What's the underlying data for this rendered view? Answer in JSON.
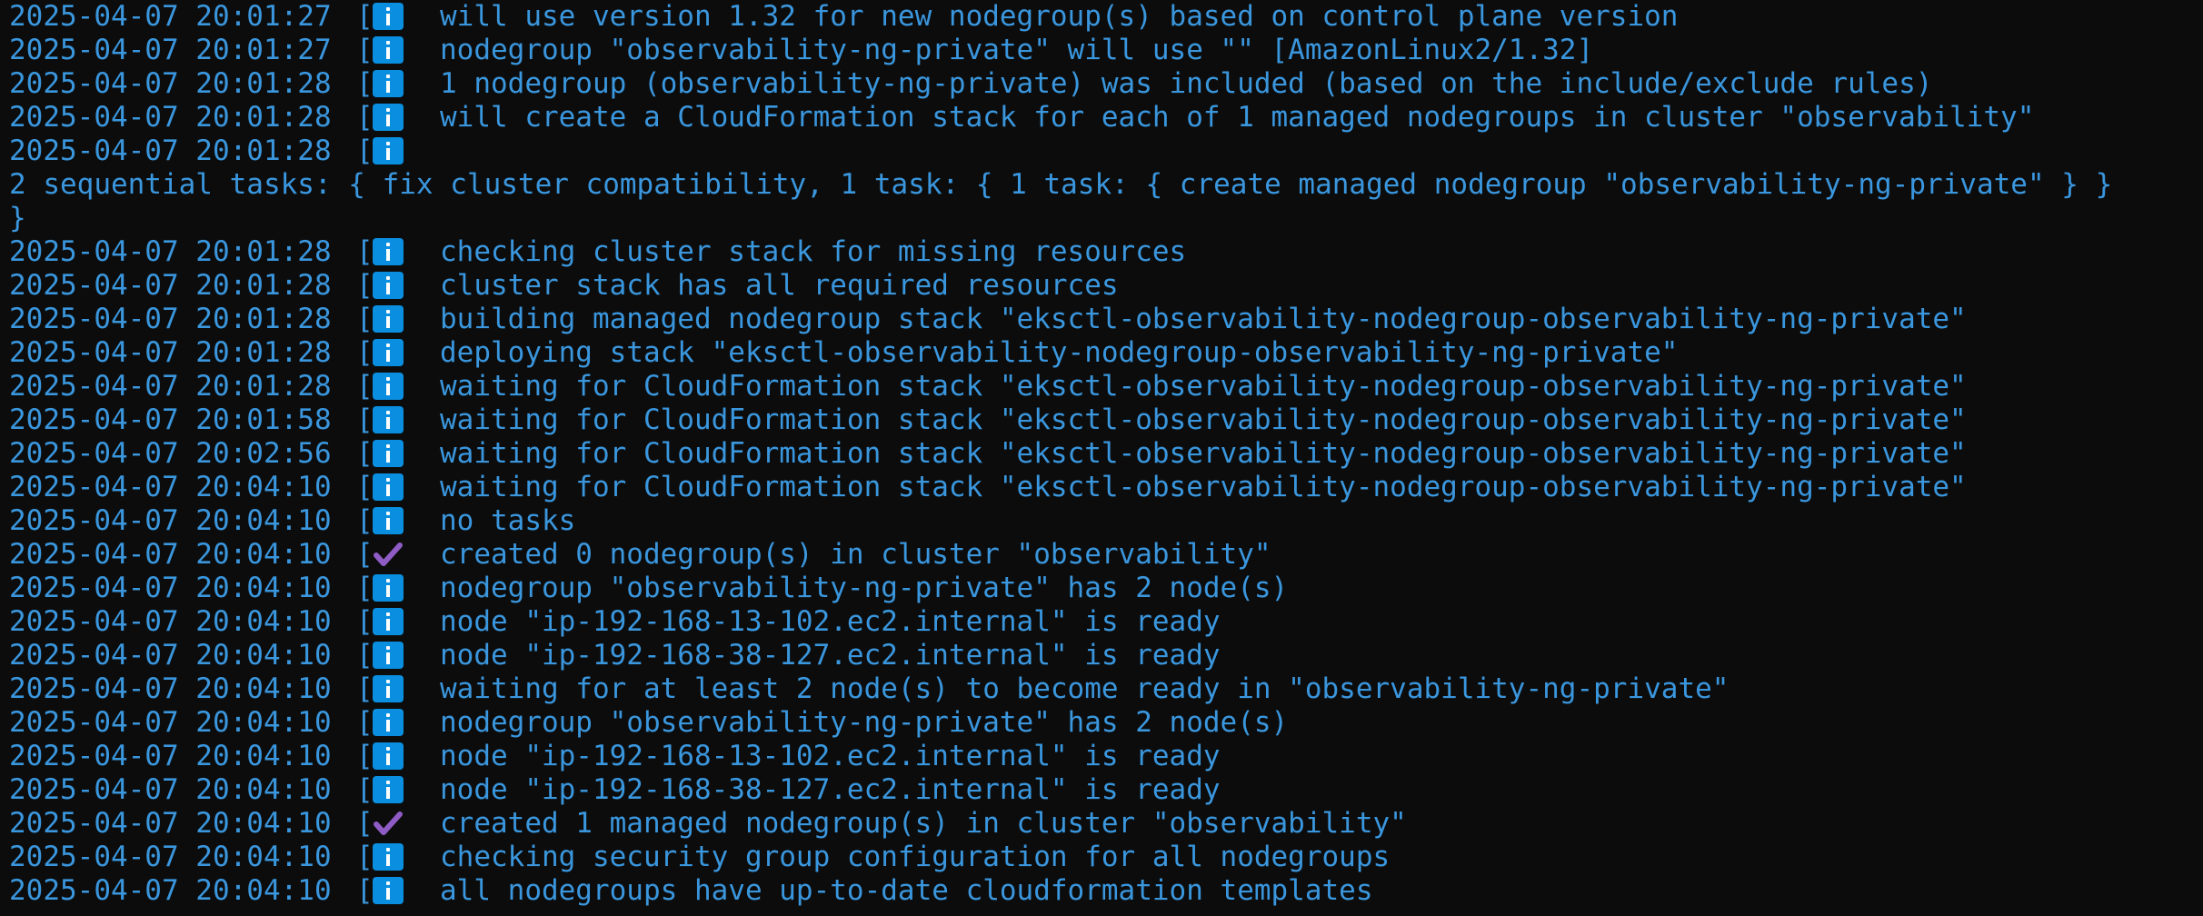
{
  "terminal": {
    "colors": {
      "background": "#0c0c0c",
      "text": "#3a96dd",
      "info_icon": "#0a8fe0",
      "check_icon": "#8e5cc4"
    },
    "lines": [
      {
        "ts": "2025-04-07 20:01:27",
        "icon": "info",
        "msg": "will use version 1.32 for new nodegroup(s) based on control plane version"
      },
      {
        "ts": "2025-04-07 20:01:27",
        "icon": "info",
        "msg": "nodegroup \"observability-ng-private\" will use \"\" [AmazonLinux2/1.32]"
      },
      {
        "ts": "2025-04-07 20:01:28",
        "icon": "info",
        "msg": "1 nodegroup (observability-ng-private) was included (based on the include/exclude rules)"
      },
      {
        "ts": "2025-04-07 20:01:28",
        "icon": "info",
        "msg": "will create a CloudFormation stack for each of 1 managed nodegroups in cluster \"observability\""
      },
      {
        "ts": "2025-04-07 20:01:28",
        "icon": "info",
        "msg": ""
      },
      {
        "plain": "2 sequential tasks: { fix cluster compatibility, 1 task: { 1 task: { create managed nodegroup \"observability-ng-private\" } }"
      },
      {
        "plain": "}"
      },
      {
        "ts": "2025-04-07 20:01:28",
        "icon": "info",
        "msg": "checking cluster stack for missing resources"
      },
      {
        "ts": "2025-04-07 20:01:28",
        "icon": "info",
        "msg": "cluster stack has all required resources"
      },
      {
        "ts": "2025-04-07 20:01:28",
        "icon": "info",
        "msg": "building managed nodegroup stack \"eksctl-observability-nodegroup-observability-ng-private\""
      },
      {
        "ts": "2025-04-07 20:01:28",
        "icon": "info",
        "msg": "deploying stack \"eksctl-observability-nodegroup-observability-ng-private\""
      },
      {
        "ts": "2025-04-07 20:01:28",
        "icon": "info",
        "msg": "waiting for CloudFormation stack \"eksctl-observability-nodegroup-observability-ng-private\""
      },
      {
        "ts": "2025-04-07 20:01:58",
        "icon": "info",
        "msg": "waiting for CloudFormation stack \"eksctl-observability-nodegroup-observability-ng-private\""
      },
      {
        "ts": "2025-04-07 20:02:56",
        "icon": "info",
        "msg": "waiting for CloudFormation stack \"eksctl-observability-nodegroup-observability-ng-private\""
      },
      {
        "ts": "2025-04-07 20:04:10",
        "icon": "info",
        "msg": "waiting for CloudFormation stack \"eksctl-observability-nodegroup-observability-ng-private\""
      },
      {
        "ts": "2025-04-07 20:04:10",
        "icon": "info",
        "msg": "no tasks"
      },
      {
        "ts": "2025-04-07 20:04:10",
        "icon": "check",
        "msg": "created 0 nodegroup(s) in cluster \"observability\""
      },
      {
        "ts": "2025-04-07 20:04:10",
        "icon": "info",
        "msg": "nodegroup \"observability-ng-private\" has 2 node(s)"
      },
      {
        "ts": "2025-04-07 20:04:10",
        "icon": "info",
        "msg": "node \"ip-192-168-13-102.ec2.internal\" is ready"
      },
      {
        "ts": "2025-04-07 20:04:10",
        "icon": "info",
        "msg": "node \"ip-192-168-38-127.ec2.internal\" is ready"
      },
      {
        "ts": "2025-04-07 20:04:10",
        "icon": "info",
        "msg": "waiting for at least 2 node(s) to become ready in \"observability-ng-private\""
      },
      {
        "ts": "2025-04-07 20:04:10",
        "icon": "info",
        "msg": "nodegroup \"observability-ng-private\" has 2 node(s)"
      },
      {
        "ts": "2025-04-07 20:04:10",
        "icon": "info",
        "msg": "node \"ip-192-168-13-102.ec2.internal\" is ready"
      },
      {
        "ts": "2025-04-07 20:04:10",
        "icon": "info",
        "msg": "node \"ip-192-168-38-127.ec2.internal\" is ready"
      },
      {
        "ts": "2025-04-07 20:04:10",
        "icon": "check",
        "msg": "created 1 managed nodegroup(s) in cluster \"observability\""
      },
      {
        "ts": "2025-04-07 20:04:10",
        "icon": "info",
        "msg": "checking security group configuration for all nodegroups"
      },
      {
        "ts": "2025-04-07 20:04:10",
        "icon": "info",
        "msg": "all nodegroups have up-to-date cloudformation templates"
      }
    ]
  }
}
